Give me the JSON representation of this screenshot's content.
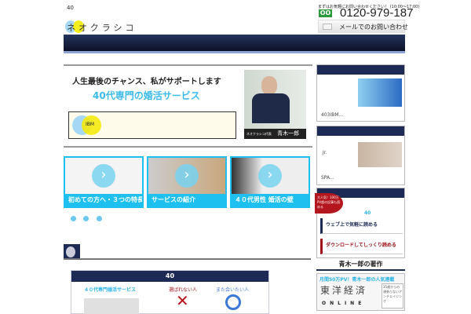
{
  "header": {
    "tagline": "40",
    "logo": "ネオクラシコ",
    "contact_note": "まずはお気軽にお問い合わせください！ (10:00〜17:00)",
    "phone": "0120-979-187",
    "freedial_icon": "free-dial-icon",
    "mail_button": "メールでのお問い合わせ"
  },
  "hero": {
    "headline": "人生最後のチャンス、私がサポートします",
    "subtitle": "40代専門の婚活サービス",
    "badge": "IBM",
    "photo_caption_role": "ネオクラシコ代表",
    "photo_caption_name": "青木一郎"
  },
  "tiles": [
    {
      "label": "初めての方へ・３つの特長"
    },
    {
      "label": "サービスの紹介"
    },
    {
      "label": "４０代男性 婚活の壁"
    }
  ],
  "compare": {
    "header": "40",
    "col1": "４０代専門婚活サービス",
    "col2": "選ばれない人",
    "col3": "また会いたい人"
  },
  "sidebar": {
    "box1_text": "403IBM...",
    "box2_jr": "Jr.",
    "box2_text": "SPA...",
    "box3_badge": "大人気！100万PV超の記事も読める",
    "box3_title": "40",
    "link1": "ウェブ上で気軽に読める",
    "link2": "ダウンロードしてしっくり読める",
    "books_title": "青木一郎の著作",
    "serial_title": "月間50万PV！青木一郎の人気連載",
    "toyo": "東洋経済",
    "online": "ONLINE",
    "book_cover": "35歳からの頑張らないアンチエイジング"
  }
}
